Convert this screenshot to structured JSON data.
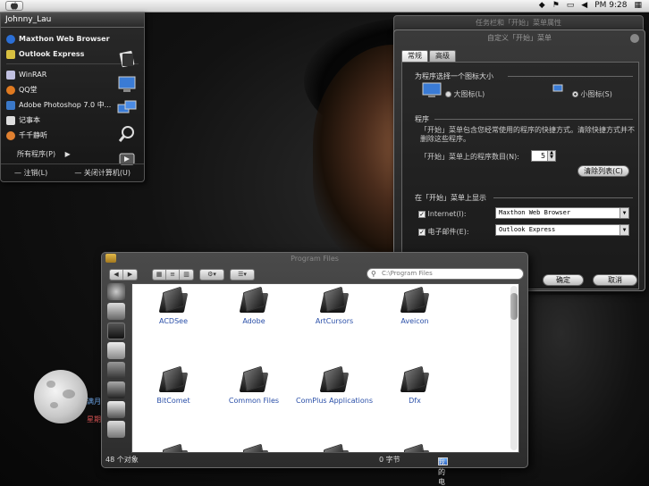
{
  "menubar": {
    "apple": "",
    "time": "PM 9:28",
    "icons": [
      "diamond-icon",
      "flag-icon",
      "display-icon",
      "volume-icon"
    ]
  },
  "start_menu": {
    "user": "Johnny_Lau",
    "pinned": [
      {
        "label": "Maxthon Web Browser",
        "icon": "maxthon-icon",
        "color": "#2b6fd6"
      },
      {
        "label": "Outlook Express",
        "icon": "outlook-icon",
        "color": "#d8c040"
      }
    ],
    "recent": [
      {
        "label": "WinRAR",
        "icon": "winrar-icon",
        "color": "#c0c0e0"
      },
      {
        "label": "QQ堂",
        "icon": "qq-icon",
        "color": "#e07a20"
      },
      {
        "label": "Adobe Photoshop 7.0 中...",
        "icon": "photoshop-icon",
        "color": "#3a78c8"
      },
      {
        "label": "记事本",
        "icon": "notepad-icon",
        "color": "#dddddd"
      },
      {
        "label": "千千静听",
        "icon": "ttplayer-icon",
        "color": "#e08030"
      }
    ],
    "all_programs": "所有程序(P)",
    "logoff": "注销(L)",
    "shutdown": "关闭计算机(U)"
  },
  "back_window": {
    "title": "任务栏和「开始」菜单属性"
  },
  "dialog": {
    "title": "自定义「开始」菜单",
    "tabs": [
      "常规",
      "高级"
    ],
    "icon_group": "为程序选择一个图标大小",
    "large_icon": "大图标(L)",
    "small_icon": "小图标(S)",
    "programs_group": "程序",
    "programs_desc": "「开始」菜单包含您经常使用的程序的快捷方式。清除快捷方式并不删除这些程序。",
    "count_label": "「开始」菜单上的程序数目(N):",
    "count_value": "5",
    "clear_button": "清除列表(C)",
    "show_group": "在「开始」菜单上显示",
    "internet_label": "Internet(I):",
    "internet_value": "Maxthon Web Browser",
    "email_label": "电子邮件(E):",
    "email_value": "Outlook Express",
    "ok": "确定",
    "cancel": "取消"
  },
  "explorer": {
    "title": "Program Files",
    "search_placeholder": "C:\\Program Files",
    "folders": [
      "ACDSee",
      "Adobe",
      "ArtCursors",
      "Aveicon",
      "BitComet",
      "Common Files",
      "ComPlus Applications",
      "Dfx"
    ],
    "status_count": "48 个对象",
    "status_size": "0 字节",
    "status_location": "我的电脑"
  },
  "moon_widget": {
    "line1": "满月",
    "line2": "星期"
  }
}
